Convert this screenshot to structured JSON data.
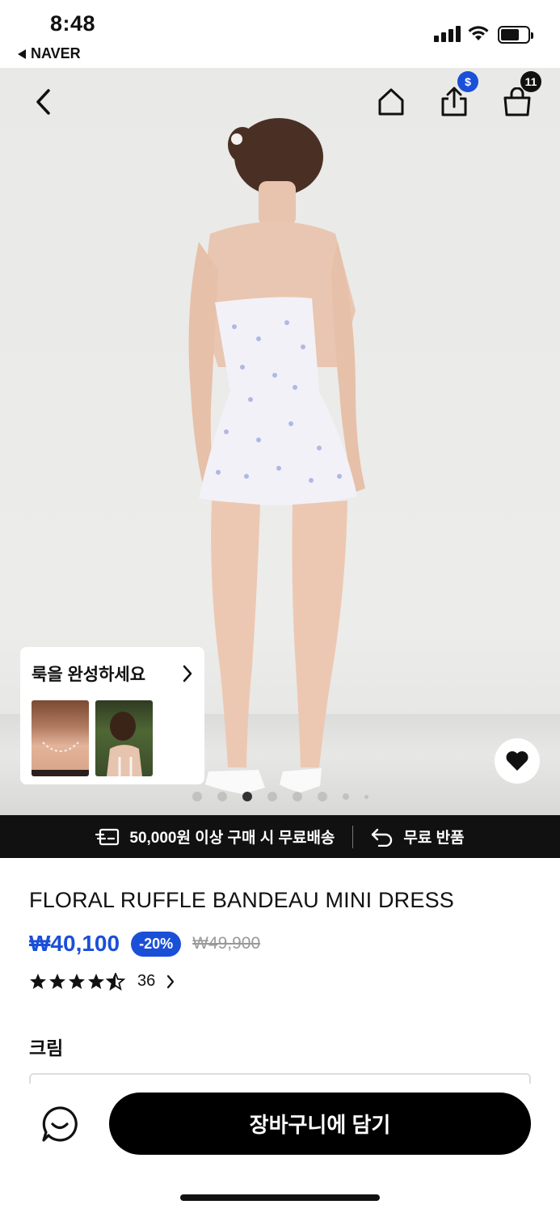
{
  "status_bar": {
    "time": "8:48",
    "back_app": "NAVER"
  },
  "header": {
    "share_badge": "$",
    "cart_count": "11"
  },
  "look_card": {
    "title": "룩을 완성하세요"
  },
  "carousel": {
    "total": 8,
    "active_index": 2
  },
  "shipping_banner": {
    "free_shipping": "50,000원 이상 구매 시 무료배송",
    "free_return": "무료 반품"
  },
  "product": {
    "name": "FLORAL RUFFLE BANDEAU MINI DRESS",
    "price": "₩40,100",
    "discount": "-20%",
    "original_price": "₩49,900",
    "rating": 4.5,
    "review_count": "36",
    "color": "크림"
  },
  "bottom_bar": {
    "add_to_cart": "장바구니에 담기"
  },
  "colors": {
    "accent": "#1a4fd8",
    "banner_bg": "#111111"
  }
}
